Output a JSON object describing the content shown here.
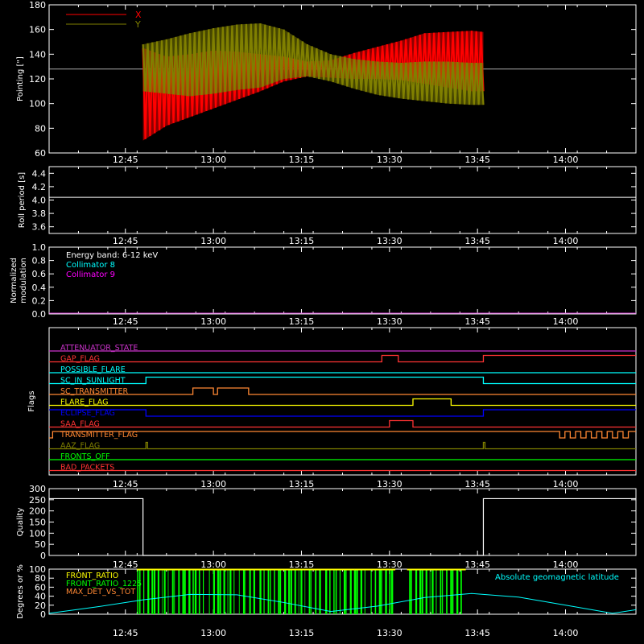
{
  "time_ticks": [
    "12:45",
    "13:00",
    "13:15",
    "13:30",
    "13:45",
    "14:00"
  ],
  "chart_data": [
    {
      "type": "line",
      "ylabel": "Pointing [\"]",
      "ylim": [
        60,
        180
      ],
      "yticks": [
        "60",
        "80",
        "100",
        "120",
        "140",
        "160",
        "180"
      ],
      "legend": [
        {
          "label": "X",
          "color": "#ff0000"
        },
        {
          "label": "Y",
          "color": "#808000"
        }
      ],
      "reference_line": 128,
      "data_start": "12:48",
      "data_end": "13:46",
      "series": [
        {
          "name": "X",
          "color": "#ff0000",
          "x": [
            "12:48",
            "12:52",
            "12:56",
            "13:00",
            "13:04",
            "13:08",
            "13:12",
            "13:16",
            "13:20",
            "13:24",
            "13:28",
            "13:32",
            "13:36",
            "13:40",
            "13:44",
            "13:46"
          ],
          "y_upper": [
            145,
            138,
            140,
            143,
            142,
            140,
            138,
            134,
            135,
            141,
            146,
            151,
            157,
            158,
            159,
            158
          ],
          "y_lower": [
            70,
            82,
            89,
            96,
            103,
            110,
            118,
            122,
            121,
            120,
            120,
            119,
            116,
            113,
            110,
            110
          ]
        },
        {
          "name": "Y",
          "color": "#808000",
          "x": [
            "12:48",
            "12:52",
            "12:56",
            "13:00",
            "13:04",
            "13:08",
            "13:12",
            "13:16",
            "13:20",
            "13:24",
            "13:28",
            "13:32",
            "13:36",
            "13:40",
            "13:44",
            "13:46"
          ],
          "y_upper": [
            148,
            152,
            157,
            161,
            164,
            165,
            160,
            148,
            140,
            136,
            134,
            133,
            134,
            134,
            133,
            133
          ],
          "y_lower": [
            110,
            108,
            106,
            108,
            111,
            113,
            120,
            122,
            118,
            112,
            107,
            104,
            102,
            100,
            99,
            99
          ]
        }
      ]
    },
    {
      "type": "line",
      "ylabel": "Roll period [s]",
      "ylim": [
        3.5,
        4.5
      ],
      "yticks": [
        "3.6",
        "3.8",
        "4.0",
        "4.2",
        "4.4"
      ],
      "series": [
        {
          "x": [
            "12:32",
            "14:12"
          ],
          "y": [
            4.04,
            4.04
          ],
          "color": "#ffffff"
        }
      ]
    },
    {
      "type": "line",
      "ylabel": "Normalized",
      "ylabel2": "modulation",
      "ylim": [
        0,
        1
      ],
      "yticks": [
        "0.0",
        "0.2",
        "0.4",
        "0.6",
        "0.8",
        "1.0"
      ],
      "annotation": "Energy band: 6-12 keV",
      "legend": [
        {
          "label": "Collimator 8",
          "color": "#00ffff"
        },
        {
          "label": "Collimator 9",
          "color": "#ff00ff"
        }
      ],
      "series": [
        {
          "name": "Collimator 9",
          "x": [
            "12:32",
            "14:12"
          ],
          "y": [
            0.0,
            0.0
          ],
          "color": "#cc33cc"
        }
      ]
    },
    {
      "type": "line",
      "ylabel": "Flags",
      "flags": [
        {
          "label": "ATTENUATOR_STATE",
          "color": "#cc33cc",
          "segments": [
            [
              0,
              100,
              0
            ]
          ]
        },
        {
          "label": "GAP_FLAG",
          "color": "#ff3333",
          "segments": [
            [
              0,
              56.7,
              0
            ],
            [
              56.7,
              59.5,
              1
            ],
            [
              59.5,
              74,
              0
            ],
            [
              74,
              100,
              1
            ]
          ]
        },
        {
          "label": "POSSIBLE_FLARE",
          "color": "#00ffff",
          "segments": [
            [
              0,
              100,
              0
            ]
          ]
        },
        {
          "label": "SC_IN_SUNLIGHT",
          "color": "#00ffff",
          "segments": [
            [
              0,
              16.5,
              0
            ],
            [
              16.5,
              74,
              1
            ],
            [
              74,
              100,
              0
            ]
          ]
        },
        {
          "label": "SC_TRANSMITTER",
          "color": "#ff8833",
          "segments": [
            [
              0,
              24.5,
              0
            ],
            [
              24.5,
              28,
              1
            ],
            [
              28,
              28.7,
              0
            ],
            [
              28.7,
              34,
              1
            ],
            [
              34,
              100,
              0
            ]
          ]
        },
        {
          "label": "FLARE_FLAG",
          "color": "#ffff00",
          "segments": [
            [
              0,
              62,
              0
            ],
            [
              62,
              68.5,
              1
            ],
            [
              68.5,
              100,
              0
            ]
          ]
        },
        {
          "label": "ECLIPSE_FLAG",
          "color": "#0000ff",
          "segments": [
            [
              0,
              16.5,
              1
            ],
            [
              16.5,
              74,
              0
            ],
            [
              74,
              100,
              1
            ]
          ]
        },
        {
          "label": "SAA_FLAG",
          "color": "#ff3333",
          "segments": [
            [
              0,
              58,
              0
            ],
            [
              58,
              62,
              1
            ],
            [
              62,
              100,
              0
            ]
          ]
        },
        {
          "label": "TRANSMITTER_FLAG",
          "color": "#ff8833",
          "segments": [
            [
              0,
              0.6,
              0
            ],
            [
              0.6,
              1.2,
              1
            ],
            [
              1.2,
              1.8,
              0
            ],
            [
              1.8,
              100,
              1
            ]
          ],
          "toggle_from": 87,
          "toggle_to": 99
        },
        {
          "label": "AAZ_FLAG",
          "color": "#808000",
          "spikes": [
            16.5,
            74
          ]
        },
        {
          "label": "FRONTS_OFF",
          "color": "#00ff00",
          "segments": [
            [
              0,
              100,
              0
            ]
          ]
        },
        {
          "label": "BAD_PACKETS",
          "color": "#ff3333",
          "segments": [
            [
              0,
              100,
              0
            ]
          ]
        }
      ]
    },
    {
      "type": "line",
      "ylabel": "Quality",
      "ylim": [
        0,
        300
      ],
      "yticks": [
        "0",
        "50",
        "100",
        "150",
        "200",
        "250",
        "300"
      ],
      "series": [
        {
          "x": [
            "12:32",
            "12:48",
            "12:48",
            "13:46",
            "13:46",
            "14:12"
          ],
          "y": [
            255,
            255,
            0,
            0,
            255,
            255
          ],
          "color": "#ffffff"
        }
      ]
    },
    {
      "type": "line",
      "ylabel": "Degrees or %",
      "ylim": [
        0,
        100
      ],
      "yticks": [
        "0",
        "20",
        "40",
        "60",
        "80",
        "100"
      ],
      "legend": [
        {
          "label": "FRONT_RATIO",
          "color": "#ffff00"
        },
        {
          "label": "FRONT_RATIO_1225",
          "color": "#00ff00"
        },
        {
          "label": "MAX_DET_VS_TOT",
          "color": "#ff8833"
        }
      ],
      "annotation": "Absolute geomagnetic latitude",
      "annotation_color": "#00ffff",
      "latitude": {
        "x": [
          "12:32",
          "12:40",
          "12:48",
          "12:56",
          "13:04",
          "13:12",
          "13:20",
          "13:28",
          "13:36",
          "13:44",
          "13:52",
          "14:00",
          "14:08",
          "14:12"
        ],
        "y": [
          2,
          16,
          32,
          44,
          43,
          26,
          6,
          18,
          37,
          46,
          38,
          20,
          2,
          10
        ]
      },
      "front_ratio_1225_bands": [
        [
          "12:47",
          "13:04"
        ],
        [
          "13:04",
          "13:24"
        ],
        [
          "13:24",
          "13:31"
        ],
        [
          "13:33",
          "13:40"
        ],
        [
          "13:40",
          "13:43"
        ]
      ]
    }
  ]
}
